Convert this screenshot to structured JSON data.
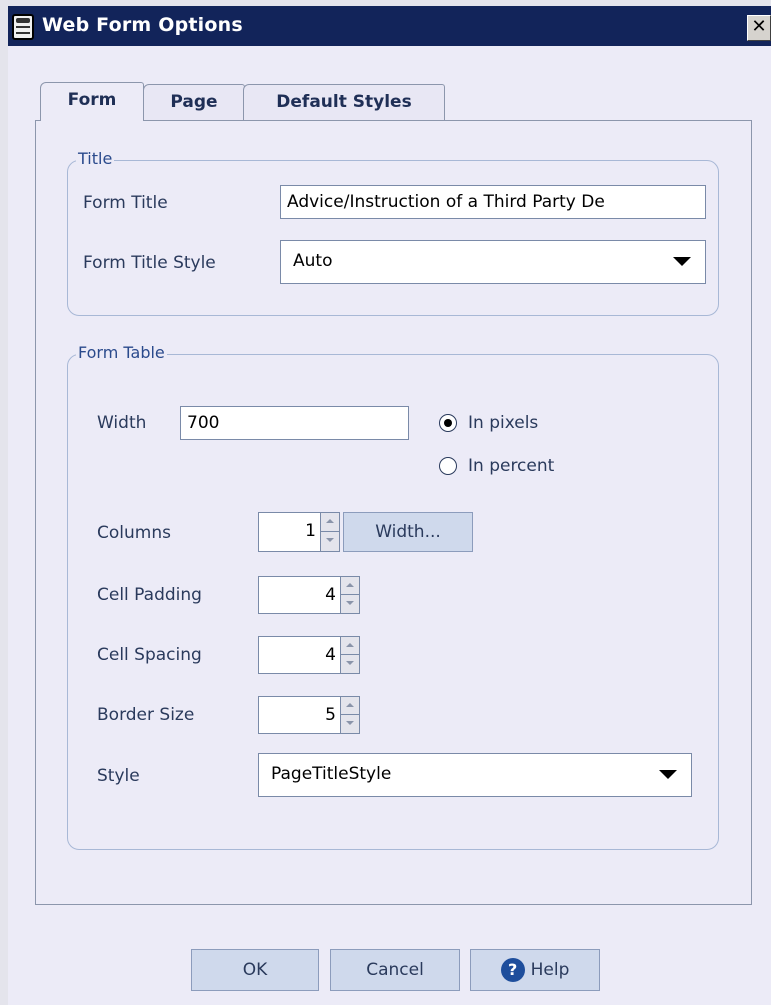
{
  "window": {
    "title": "Web Form Options",
    "close_glyph": "✕"
  },
  "tabs": [
    {
      "label": "Form",
      "active": true
    },
    {
      "label": "Page",
      "active": false
    },
    {
      "label": "Default Styles",
      "active": false
    }
  ],
  "title_group": {
    "legend": "Title",
    "form_title_label": "Form Title",
    "form_title_value": "Advice/Instruction of a Third Party De",
    "form_title_style_label": "Form Title Style",
    "form_title_style_value": "Auto"
  },
  "table_group": {
    "legend": "Form Table",
    "width_label": "Width",
    "width_value": "700",
    "radio_pixels_label": "In pixels",
    "radio_percent_label": "In percent",
    "radio_selected": "In pixels",
    "columns_label": "Columns",
    "columns_value": "1",
    "columns_width_button": "Width...",
    "cell_padding_label": "Cell Padding",
    "cell_padding_value": "4",
    "cell_spacing_label": "Cell Spacing",
    "cell_spacing_value": "4",
    "border_size_label": "Border Size",
    "border_size_value": "5",
    "style_label": "Style",
    "style_value": "PageTitleStyle"
  },
  "buttons": {
    "ok": "OK",
    "cancel": "Cancel",
    "help": "Help",
    "help_icon_glyph": "?"
  },
  "colors": {
    "titlebar": "#12245a",
    "background": "#ecebf7",
    "button": "#cfd9ec",
    "legend_text": "#2a4a8c"
  },
  "icons": [
    "app-icon",
    "close-icon",
    "help-icon",
    "dropdown-arrow-icon",
    "spin-up-icon",
    "spin-down-icon"
  ]
}
